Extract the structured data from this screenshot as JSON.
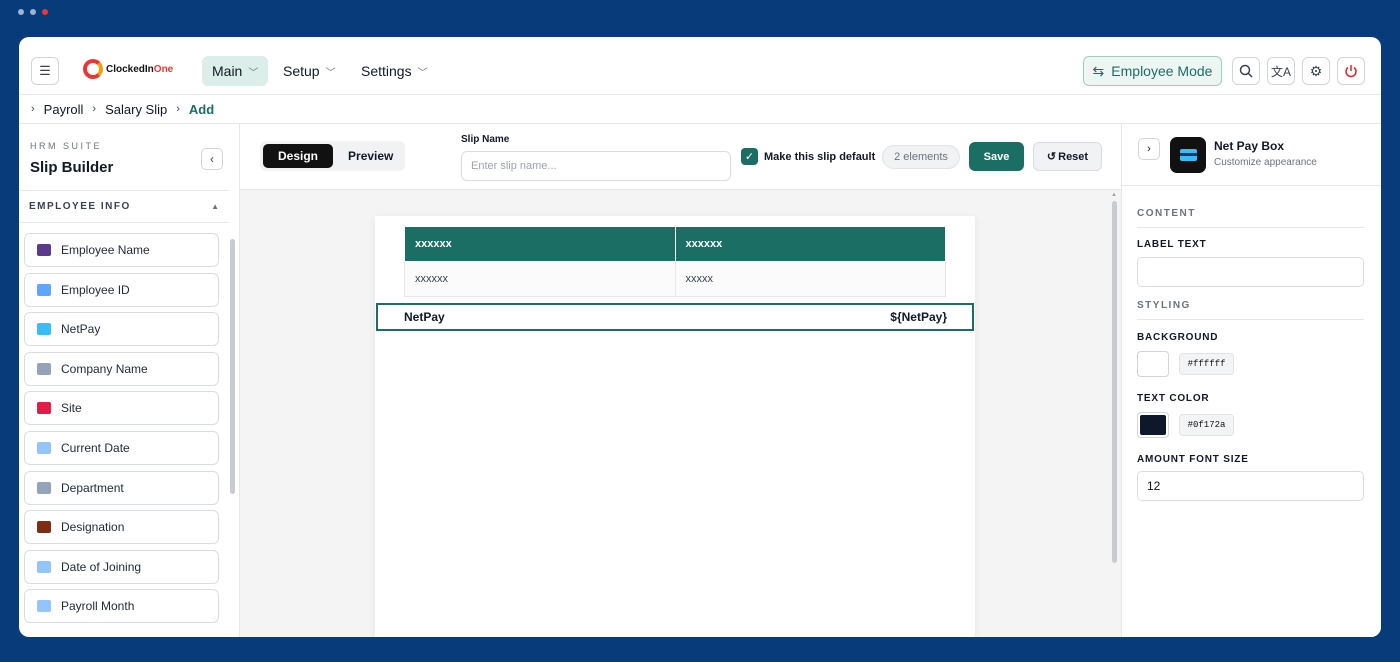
{
  "colors": {
    "accent": "#1b6e63",
    "frame": "#083b7a",
    "dot1": "#9db3d6",
    "dot2": "#9db3d6",
    "dot3": "#e53935"
  },
  "brand": {
    "name_a": "ClockedIn",
    "name_b": "One"
  },
  "nav": {
    "main": "Main",
    "setup": "Setup",
    "settings": "Settings",
    "employee_mode": "Employee Mode"
  },
  "breadcrumb": {
    "a": "Payroll",
    "b": "Salary Slip",
    "c": "Add"
  },
  "sidebar": {
    "suite": "HRM SUITE",
    "title": "Slip Builder",
    "section": "EMPLOYEE INFO",
    "items": [
      {
        "label": "Employee Name",
        "icon": "person-icon",
        "color": "#5b3a8c"
      },
      {
        "label": "Employee ID",
        "icon": "id-card-icon",
        "color": "#60a5fa"
      },
      {
        "label": "NetPay",
        "icon": "credit-card-icon",
        "color": "#38bdf8"
      },
      {
        "label": "Company Name",
        "icon": "building-icon",
        "color": "#94a3b8"
      },
      {
        "label": "Site",
        "icon": "pin-icon",
        "color": "#e11d48"
      },
      {
        "label": "Current Date",
        "icon": "calendar-icon",
        "color": "#93c5fd"
      },
      {
        "label": "Department",
        "icon": "building-icon",
        "color": "#94a3b8"
      },
      {
        "label": "Designation",
        "icon": "briefcase-icon",
        "color": "#7c2d12"
      },
      {
        "label": "Date of Joining",
        "icon": "calendar-icon",
        "color": "#93c5fd"
      },
      {
        "label": "Payroll Month",
        "icon": "calendar-icon",
        "color": "#93c5fd"
      }
    ]
  },
  "toolbar": {
    "design": "Design",
    "preview": "Preview",
    "slip_name_label": "Slip Name",
    "slip_name_value": "",
    "slip_name_placeholder": "Enter slip name...",
    "default_label": "Make this slip default",
    "default_checked": true,
    "elements": "2 elements",
    "save": "Save",
    "reset": "Reset"
  },
  "canvas": {
    "table": {
      "header": [
        "xxxxxx",
        "xxxxxx"
      ],
      "row": [
        "xxxxxx",
        "xxxxx"
      ]
    },
    "netpay": {
      "label": "NetPay",
      "value": "${NetPay}"
    }
  },
  "panel": {
    "title": "Net Pay Box",
    "subtitle": "Customize appearance",
    "content": "CONTENT",
    "label_text": "LABEL TEXT",
    "label_value": "",
    "styling": "STYLING",
    "background": "BACKGROUND",
    "background_hex": "#ffffff",
    "text_color": "TEXT COLOR",
    "text_hex": "#0f172a",
    "amount_font_size": "AMOUNT FONT SIZE",
    "amount_font_value": "12"
  }
}
